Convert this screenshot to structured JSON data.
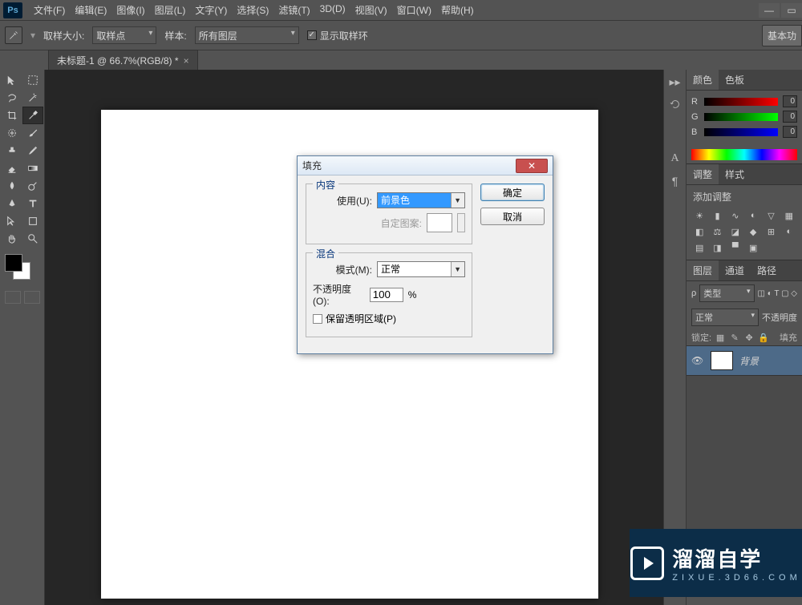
{
  "menu": [
    "文件(F)",
    "编辑(E)",
    "图像(I)",
    "图层(L)",
    "文字(Y)",
    "选择(S)",
    "滤镜(T)",
    "3D(D)",
    "视图(V)",
    "窗口(W)",
    "帮助(H)"
  ],
  "options": {
    "sample_size_label": "取样大小:",
    "sample_size_value": "取样点",
    "sample_label": "样本:",
    "sample_value": "所有图层",
    "show_ring": "显示取样环",
    "right_label": "基本功"
  },
  "doc_tab": {
    "title": "未标题-1 @ 66.7%(RGB/8) *"
  },
  "color_panel": {
    "tabs": [
      "颜色",
      "色板"
    ],
    "channels": [
      {
        "label": "R",
        "value": "0",
        "gradient": "linear-gradient(to right,#000,#F00)"
      },
      {
        "label": "G",
        "value": "0",
        "gradient": "linear-gradient(to right,#000,#0F0)"
      },
      {
        "label": "B",
        "value": "0",
        "gradient": "linear-gradient(to right,#000,#00F)"
      }
    ]
  },
  "adjust_panel": {
    "tabs": [
      "调整",
      "样式"
    ],
    "title": "添加调整"
  },
  "layers_panel": {
    "tabs": [
      "图层",
      "通道",
      "路径"
    ],
    "kind": "类型",
    "mode": "正常",
    "opacity_label": "不透明度",
    "lock_label": "锁定:",
    "fill_label": "填充",
    "layer_name": "背景"
  },
  "dialog": {
    "title": "填充",
    "content_legend": "内容",
    "use_label": "使用(U):",
    "use_value": "前景色",
    "custom_pattern_label": "自定图案:",
    "blend_legend": "混合",
    "mode_label": "模式(M):",
    "mode_value": "正常",
    "opacity_label": "不透明度(O):",
    "opacity_value": "100",
    "percent": "%",
    "preserve_label": "保留透明区域(P)",
    "ok": "确定",
    "cancel": "取消"
  },
  "watermark": {
    "main": "溜溜自学",
    "sub": "ZIXUE.3D66.COM"
  }
}
